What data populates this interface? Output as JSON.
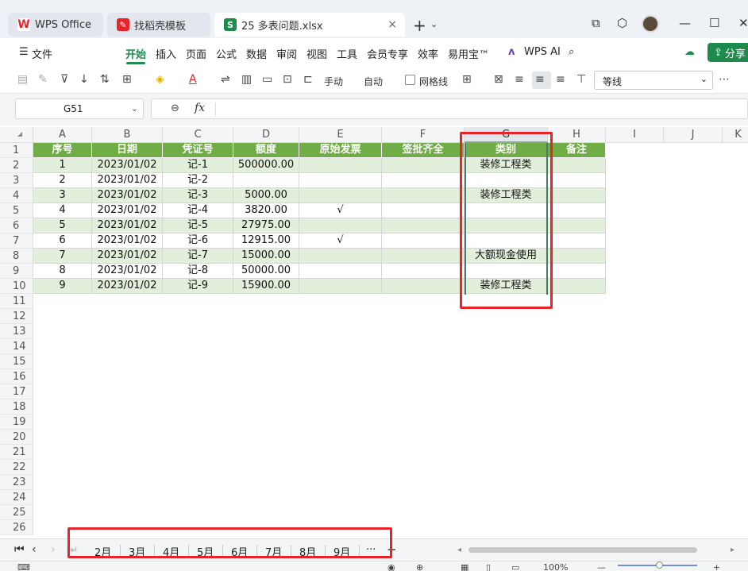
{
  "titlebar": {
    "wps_tab": "WPS Office",
    "template_tab": "找稻壳模板",
    "file_tab": "25 多表问题.xlsx",
    "file_icon": "S",
    "new_tab": "+",
    "new_tab_caret": "⌄",
    "close": "×",
    "window_icons": [
      "⧉",
      "⬡",
      "—",
      "☐",
      "✕"
    ]
  },
  "menubar": {
    "file": "文件",
    "items": [
      "开始",
      "插入",
      "页面",
      "公式",
      "数据",
      "审阅",
      "视图",
      "工具",
      "会员专享",
      "效率",
      "易用宝™"
    ],
    "wps_ai": "WPS AI",
    "share": "分享"
  },
  "toolbar": {
    "row_height_label": "手动",
    "col_width_label": "自动",
    "gridlines_label": "网格线",
    "font_name": "等线",
    "more": "⋯"
  },
  "formulabar": {
    "cell_ref": "G51",
    "fx": "fx",
    "formula": ""
  },
  "grid": {
    "columns": [
      "A",
      "B",
      "C",
      "D",
      "E",
      "F",
      "G",
      "H",
      "I",
      "J",
      "K"
    ],
    "selected_column": "G",
    "rows": [
      "1",
      "2",
      "3",
      "4",
      "5",
      "6",
      "7",
      "8",
      "9",
      "10",
      "11",
      "12",
      "13",
      "14",
      "15",
      "16",
      "17",
      "18",
      "19",
      "20",
      "21",
      "22",
      "23",
      "24",
      "25",
      "26"
    ],
    "headers": [
      "序号",
      "日期",
      "凭证号",
      "额度",
      "原始发票",
      "签批齐全",
      "类别",
      "备注"
    ],
    "data": [
      [
        "1",
        "2023/01/02",
        "记-1",
        "500000.00",
        "",
        "",
        "装修工程类",
        ""
      ],
      [
        "2",
        "2023/01/02",
        "记-2",
        "",
        "",
        "",
        "",
        ""
      ],
      [
        "3",
        "2023/01/02",
        "记-3",
        "5000.00",
        "",
        "",
        "装修工程类",
        ""
      ],
      [
        "4",
        "2023/01/02",
        "记-4",
        "3820.00",
        "√",
        "",
        "",
        ""
      ],
      [
        "5",
        "2023/01/02",
        "记-5",
        "27975.00",
        "",
        "",
        "",
        ""
      ],
      [
        "6",
        "2023/01/02",
        "记-6",
        "12915.00",
        "√",
        "",
        "",
        ""
      ],
      [
        "7",
        "2023/01/02",
        "记-7",
        "15000.00",
        "",
        "",
        "大额现金使用",
        ""
      ],
      [
        "8",
        "2023/01/02",
        "记-8",
        "50000.00",
        "",
        "",
        "",
        ""
      ],
      [
        "9",
        "2023/01/02",
        "记-9",
        "15900.00",
        "",
        "",
        "装修工程类",
        ""
      ]
    ]
  },
  "sheets": {
    "tabs": [
      "2月",
      "3月",
      "4月",
      "5月",
      "6月",
      "7月",
      "8月",
      "9月"
    ],
    "more": "···",
    "add": "+"
  },
  "statusbar": {
    "zoom": "100%",
    "minus": "—",
    "plus": "+"
  },
  "colors": {
    "accent": "#1e8a4c",
    "header_fill": "#70ad47",
    "band_fill": "#e2efda",
    "highlight_box": "#e8232a"
  }
}
